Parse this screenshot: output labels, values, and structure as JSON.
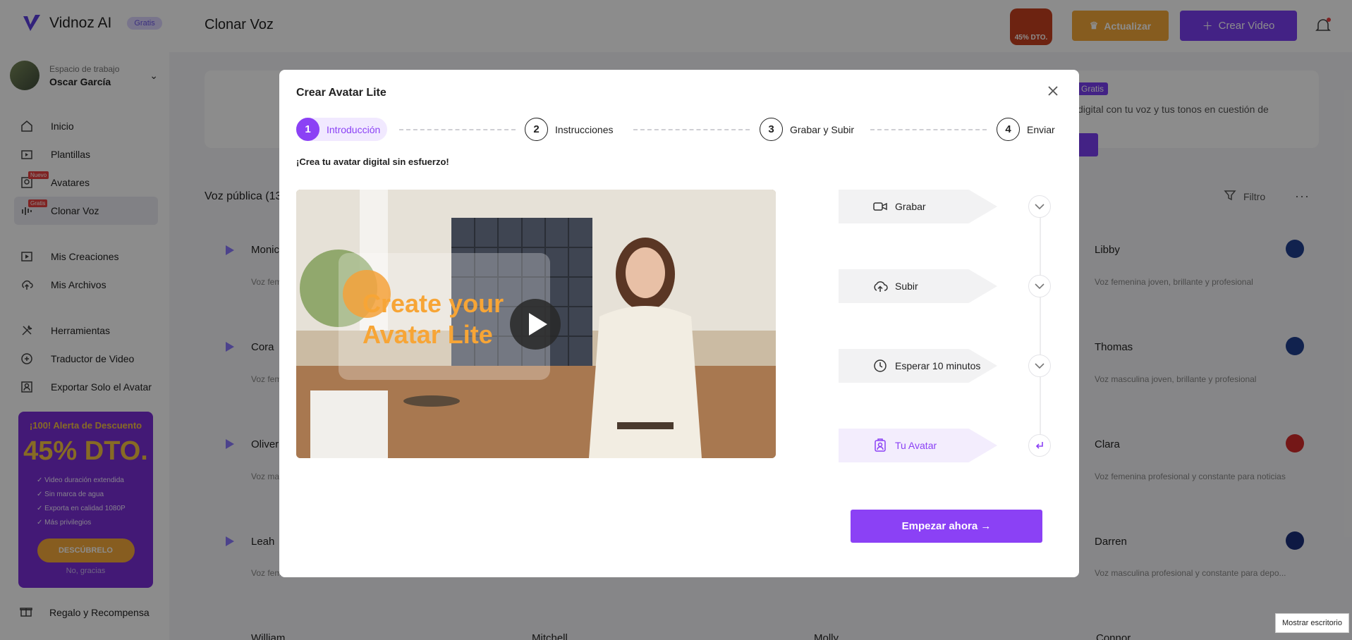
{
  "app": {
    "brand": "Vidnoz AI",
    "brand_badge": "Gratis",
    "page_title": "Clonar Voz"
  },
  "workspace": {
    "label": "Espacio de trabajo",
    "user": "Oscar García"
  },
  "sidebar": {
    "items": [
      {
        "label": "Inicio",
        "icon": "home-icon"
      },
      {
        "label": "Plantillas",
        "icon": "template-icon"
      },
      {
        "label": "Avatares",
        "icon": "avatar-icon",
        "tag": "Nuevo"
      },
      {
        "label": "Clonar Voz",
        "icon": "voice-icon",
        "tag": "Gratis"
      },
      {
        "label": "Mis Creaciones",
        "icon": "creations-icon"
      },
      {
        "label": "Mis Archivos",
        "icon": "upload-cloud-icon"
      },
      {
        "label": "Herramientas",
        "icon": "tools-icon"
      },
      {
        "label": "Traductor de Video",
        "icon": "translate-icon"
      },
      {
        "label": "Exportar Solo el Avatar",
        "icon": "export-avatar-icon"
      }
    ],
    "gift": "Regalo y Recompensa"
  },
  "promo": {
    "headline": "¡100! Alerta de Descuento",
    "discount": "45% DTO.",
    "perks": [
      "Video duración extendida",
      "Sin marca de agua",
      "Exporta en calidad 1080P",
      "Más privilegios"
    ],
    "cta": "DESCÚBRELO",
    "dismiss": "No, gracias"
  },
  "topbar": {
    "discount_badge": "45% DTO.",
    "upgrade": "Actualizar",
    "create_video": "Crear Video"
  },
  "banner": {
    "tag": "Gratis",
    "desc": "digital con tu voz y tus tonos en cuestión de"
  },
  "voices": {
    "section_title": "Voz pública (13",
    "filter_label": "Filtro",
    "left_column": [
      {
        "name": "Monic",
        "desc": "Voz fem"
      },
      {
        "name": "Cora",
        "desc": "Voz fem"
      },
      {
        "name": "Oliver",
        "desc": "Voz ma"
      },
      {
        "name": "Leah",
        "desc": "Voz fem"
      },
      {
        "name": "William",
        "desc": ""
      }
    ],
    "right_column": [
      {
        "name": "Libby",
        "desc": "Voz femenina joven, brillante y profesional",
        "flag": "uk"
      },
      {
        "name": "Thomas",
        "desc": "Voz masculina joven, brillante y profesional",
        "flag": "uk"
      },
      {
        "name": "Clara",
        "desc": "Voz femenina profesional y constante para noticias",
        "flag": "ca"
      },
      {
        "name": "Darren",
        "desc": "Voz masculina profesional y constante para depo...",
        "flag": "au"
      }
    ],
    "bottom_partial": [
      "Mitchell",
      "Molly",
      "Connor"
    ]
  },
  "modal": {
    "title": "Crear Avatar Lite",
    "steps": [
      {
        "num": "1",
        "label": "Introducción",
        "active": true
      },
      {
        "num": "2",
        "label": "Instrucciones",
        "active": false
      },
      {
        "num": "3",
        "label": "Grabar y Subir",
        "active": false
      },
      {
        "num": "4",
        "label": "Enviar",
        "active": false
      }
    ],
    "intro": "¡Crea tu avatar digital sin esfuerzo!",
    "video_caption": [
      "Create your",
      "Avatar Lite"
    ],
    "timeline": [
      {
        "label": "Grabar",
        "icon": "video-camera-icon",
        "action_icon": "chevron-down-icon"
      },
      {
        "label": "Subir",
        "icon": "upload-cloud-icon",
        "action_icon": "chevron-down-icon"
      },
      {
        "label": "Esperar 10 minutos",
        "icon": "clock-icon",
        "action_icon": "chevron-down-icon"
      },
      {
        "label": "Tu Avatar",
        "icon": "avatar-badge-icon",
        "action_icon": "return-arrow-icon"
      }
    ],
    "cta": "Empezar ahora →"
  },
  "tooltip": "Mostrar escritorio",
  "colors": {
    "accent": "#8b41f5",
    "upgrade": "#f4a83a",
    "promo_bg": "#7a2fd8"
  }
}
